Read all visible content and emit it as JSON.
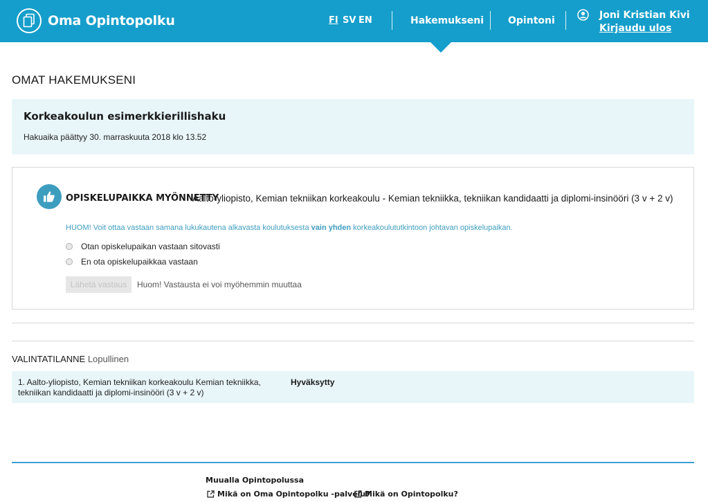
{
  "header": {
    "logo_text": "Oma Opintopolku",
    "languages": [
      "FI",
      "SV",
      "EN"
    ],
    "active_language": "FI",
    "nav": [
      "Hakemukseni",
      "Opintoni"
    ],
    "user_name": "Joni Kristian Kivi",
    "logout_label": "Kirjaudu ulos",
    "brand_color": "#159ecb"
  },
  "page": {
    "title": "OMAT HAKEMUKSENI"
  },
  "application": {
    "name": "Korkeakoulun esimerkkierillishaku",
    "deadline": "Hakuaika päättyy 30. marraskuuta 2018 klo 13.52"
  },
  "offer": {
    "status": "OPISKELUPAIKKA MYÖNNETTY",
    "program": "Aalto-yliopisto, Kemian tekniikan korkeakoulu - Kemian tekniikka, tekniikan kandidaatti ja diplomi-insinööri (3 v + 2 v)",
    "note_prefix": "HUOM! Voit ottaa vastaan samana lukukautena alkavasta koulutuksesta ",
    "note_bold": "vain yhden",
    "note_suffix": " korkeakoulututkintoon johtavan opiskelupaikan.",
    "options": [
      "Otan opiskelupaikan vastaan sitovasti",
      "En ota opiskelupaikkaa vastaan"
    ],
    "send_label": "Lähetä vastaus",
    "send_note": "Huom! Vastausta ei voi myöhemmin muuttaa"
  },
  "selection": {
    "label": "VALINTATILANNE",
    "value": "Lopullinen",
    "results": [
      {
        "program": "1. Aalto-yliopisto, Kemian tekniikan korkeakoulu Kemian tekniikka, tekniikan kandidaatti ja diplomi-insinööri (3 v + 2 v)",
        "status": "Hyväksytty"
      }
    ]
  },
  "footer": {
    "title": "Muualla Opintopolussa",
    "links": [
      "Mikä on Oma Opintopolku -palvelu?",
      "Mikä on Opintopolku?"
    ]
  }
}
